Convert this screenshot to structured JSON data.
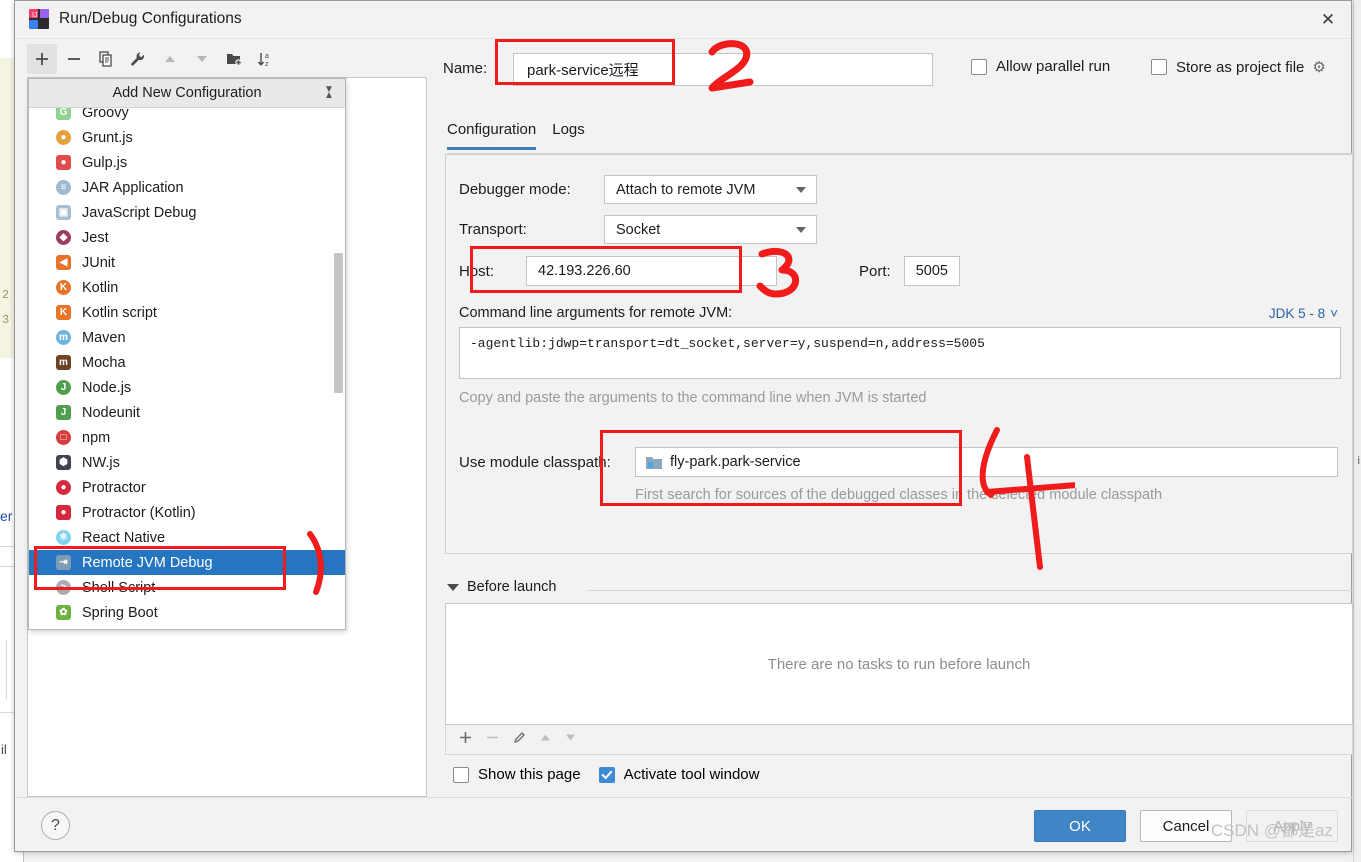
{
  "window": {
    "title": "Run/Debug Configurations",
    "app_icon": "intellij-idea-icon",
    "close_label": "✕"
  },
  "toolbar": {
    "buttons": [
      {
        "name": "add-configuration-button",
        "glyph": "+",
        "state": "active"
      },
      {
        "name": "remove-configuration-button",
        "glyph": "−",
        "state": "normal"
      },
      {
        "name": "copy-configuration-button",
        "glyph": "⧉",
        "state": "normal"
      },
      {
        "name": "edit-templates-button",
        "glyph": "ὒ7",
        "state": "normal"
      },
      {
        "name": "move-up-button",
        "glyph": "▲",
        "state": "dim"
      },
      {
        "name": "move-down-button",
        "glyph": "▼",
        "state": "dim"
      },
      {
        "name": "new-folder-button",
        "glyph": "Ὄ1",
        "state": "normal"
      },
      {
        "name": "sort-configurations-button",
        "glyph": "↓",
        "state": "normal"
      }
    ]
  },
  "add_popup": {
    "header": "Add New Configuration",
    "collapse_icon": "collapse-all-icon",
    "items": [
      {
        "label": "Groovy",
        "icon": "groovy-icon",
        "color": "#8fd18f",
        "glyph": "G",
        "selected": false
      },
      {
        "label": "Grunt.js",
        "icon": "grunt-icon",
        "color": "#e5a13a",
        "glyph": "●",
        "selected": false
      },
      {
        "label": "Gulp.js",
        "icon": "gulp-icon",
        "color": "#e04c4c",
        "glyph": "●",
        "selected": false
      },
      {
        "label": "JAR Application",
        "icon": "jar-icon",
        "color": "#9fb9cf",
        "glyph": "≡",
        "selected": false
      },
      {
        "label": "JavaScript Debug",
        "icon": "javascript-debug-icon",
        "color": "#a7bed2",
        "glyph": "▣",
        "selected": false
      },
      {
        "label": "Jest",
        "icon": "jest-icon",
        "color": "#9b3c63",
        "glyph": "◆",
        "selected": false
      },
      {
        "label": "JUnit",
        "icon": "junit-icon",
        "color": "#e8722c",
        "glyph": "◀",
        "selected": false
      },
      {
        "label": "Kotlin",
        "icon": "kotlin-icon",
        "color": "#e8742a",
        "glyph": "K",
        "selected": false
      },
      {
        "label": "Kotlin script",
        "icon": "kotlin-script-icon",
        "color": "#e8742a",
        "glyph": "K",
        "selected": false
      },
      {
        "label": "Maven",
        "icon": "maven-icon",
        "color": "#72b4dd",
        "glyph": "m",
        "selected": false
      },
      {
        "label": "Mocha",
        "icon": "mocha-icon",
        "color": "#6b4423",
        "glyph": "m",
        "selected": false
      },
      {
        "label": "Node.js",
        "icon": "nodejs-icon",
        "color": "#4f9f4f",
        "glyph": "J",
        "selected": false
      },
      {
        "label": "Nodeunit",
        "icon": "nodeunit-icon",
        "color": "#4f9f4f",
        "glyph": "J",
        "selected": false
      },
      {
        "label": "npm",
        "icon": "npm-icon",
        "color": "#d63b3b",
        "glyph": "□",
        "selected": false
      },
      {
        "label": "NW.js",
        "icon": "nwjs-icon",
        "color": "#3f4550",
        "glyph": "⬢",
        "selected": false
      },
      {
        "label": "Protractor",
        "icon": "protractor-icon",
        "color": "#d6293e",
        "glyph": "●",
        "selected": false
      },
      {
        "label": "Protractor (Kotlin)",
        "icon": "protractor-kotlin-icon",
        "color": "#d6293e",
        "glyph": "●",
        "selected": false
      },
      {
        "label": "React Native",
        "icon": "react-native-icon",
        "color": "#7fd3ec",
        "glyph": "⚛",
        "selected": false
      },
      {
        "label": "Remote JVM Debug",
        "icon": "remote-jvm-debug-icon",
        "color": "#7e9bb5",
        "glyph": "⇥",
        "selected": true
      },
      {
        "label": "Shell Script",
        "icon": "shell-script-icon",
        "color": "#a8aeb4",
        "glyph": ">",
        "selected": false
      },
      {
        "label": "Spring Boot",
        "icon": "spring-boot-icon",
        "color": "#6db33f",
        "glyph": "✿",
        "selected": false
      }
    ]
  },
  "name_field": {
    "label": "Name:",
    "value": "park-service远程"
  },
  "top_options": {
    "allow_parallel_run": {
      "label": "Allow parallel run",
      "checked": false
    },
    "store_as_project_file": {
      "label": "Store as project file",
      "checked": false,
      "gear_icon": "gear-icon"
    }
  },
  "tabs": [
    {
      "label": "Configuration",
      "active": true
    },
    {
      "label": "Logs",
      "active": false
    }
  ],
  "configuration": {
    "debugger_mode": {
      "label": "Debugger mode:",
      "value": "Attach to remote JVM"
    },
    "transport": {
      "label": "Transport:",
      "value": "Socket"
    },
    "host": {
      "label": "Host:",
      "value": "42.193.226.60"
    },
    "port": {
      "label": "Port:",
      "value": "5005"
    },
    "cmdline": {
      "label": "Command line arguments for remote JVM:",
      "jdk_selector": "JDK 5 - 8",
      "value": "-agentlib:jdwp=transport=dt_socket,server=y,suspend=n,address=5005",
      "hint": "Copy and paste the arguments to the command line when JVM is started"
    },
    "module_classpath": {
      "label": "Use module classpath:",
      "value": "fly-park.park-service",
      "icon": "module-icon",
      "hint": "First search for sources of the debugged classes in the selected module classpath"
    }
  },
  "before_launch": {
    "title": "Before launch",
    "empty_text": "There are no tasks to run before launch",
    "toolbar": [
      {
        "name": "add-task-button",
        "glyph": "+",
        "state": "normal"
      },
      {
        "name": "remove-task-button",
        "glyph": "−",
        "state": "dim"
      },
      {
        "name": "edit-task-button",
        "glyph": "✐",
        "state": "normal"
      },
      {
        "name": "task-move-up-button",
        "glyph": "▲",
        "state": "dim"
      },
      {
        "name": "task-move-down-button",
        "glyph": "▼",
        "state": "dim"
      }
    ],
    "show_this_page": {
      "label": "Show this page",
      "checked": false
    },
    "activate_tool_window": {
      "label": "Activate tool window",
      "checked": true
    }
  },
  "footer": {
    "help_label": "?",
    "ok_label": "OK",
    "cancel_label": "Cancel",
    "apply_label": "Apply"
  },
  "annotations": {
    "mark_1": "1",
    "mark_2": "2",
    "mark_3": "3",
    "mark_4": "4",
    "color": "#f21b1b"
  },
  "watermark": "CSDN @都是az",
  "background": {
    "gutter_numbers": [
      "2",
      "3"
    ],
    "word_fragment": "er",
    "word_fragment2": "il"
  }
}
